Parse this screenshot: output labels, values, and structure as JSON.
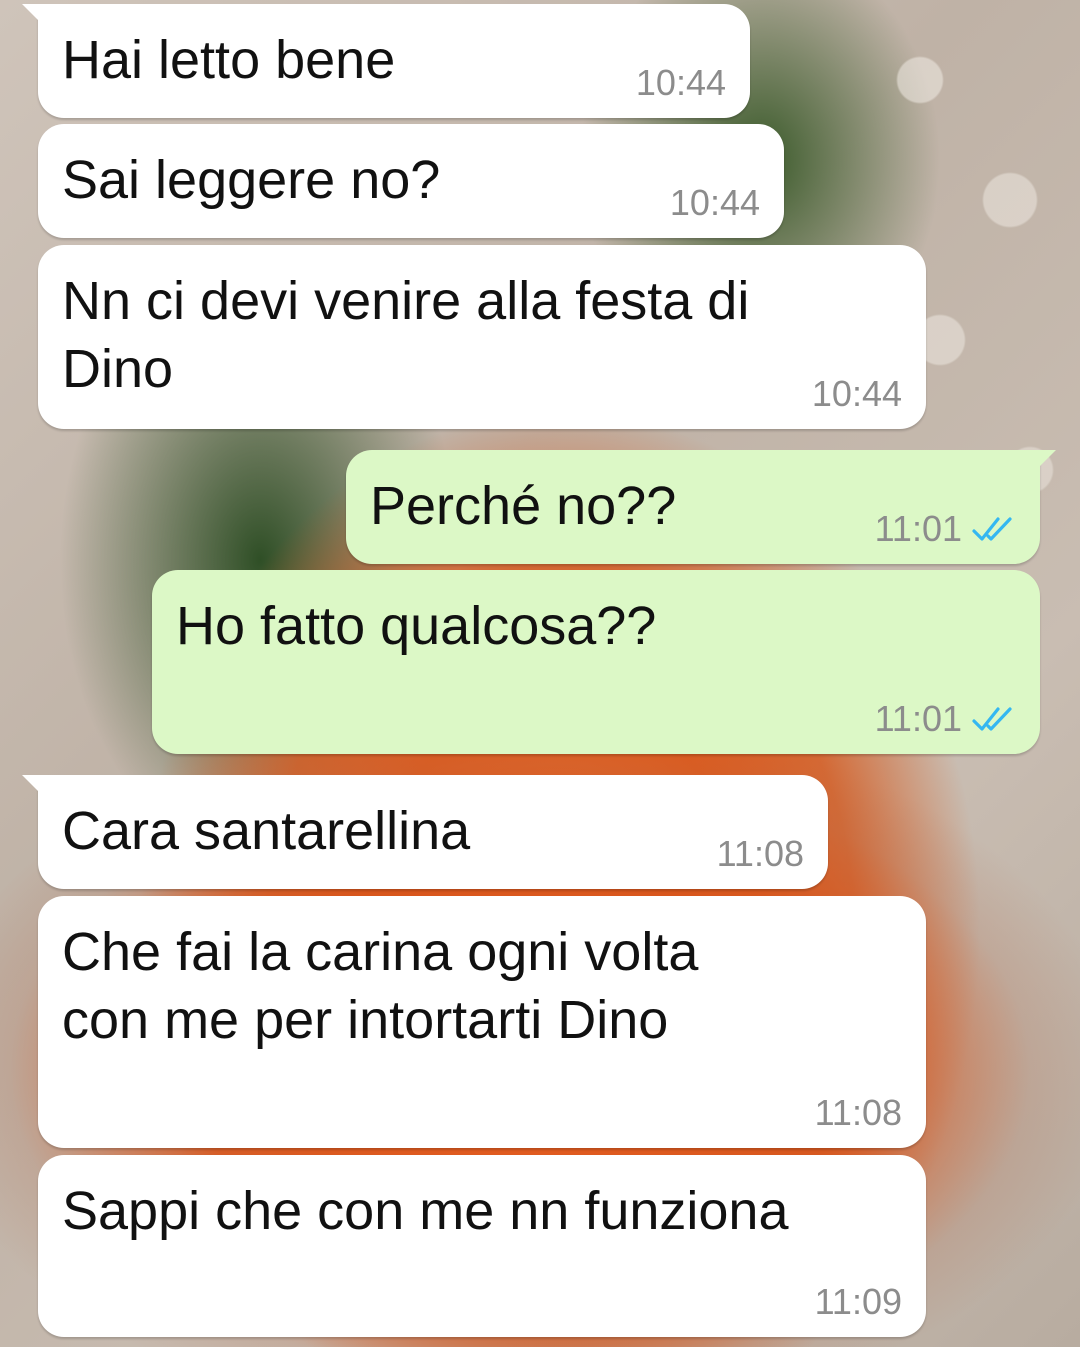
{
  "messages": [
    {
      "direction": "in",
      "text": "Hai letto bene",
      "time": "10:44"
    },
    {
      "direction": "in",
      "text": "Sai leggere no?",
      "time": "10:44"
    },
    {
      "direction": "in",
      "text": "Nn ci devi venire alla festa di\nDino",
      "time": "10:44"
    },
    {
      "direction": "out",
      "text": "Perché no??",
      "time": "11:01",
      "status": "read"
    },
    {
      "direction": "out",
      "text": "Ho fatto qualcosa??",
      "time": "11:01",
      "status": "read"
    },
    {
      "direction": "in",
      "text": "Cara santarellina",
      "time": "11:08"
    },
    {
      "direction": "in",
      "text": "Che fai la carina ogni volta\ncon me per intortarti Dino",
      "time": "11:08"
    },
    {
      "direction": "in",
      "text": "Sappi che con me nn funziona",
      "time": "11:09"
    }
  ],
  "colors": {
    "incoming_bubble": "#ffffff",
    "outgoing_bubble": "#dcf8c6",
    "read_ticks": "#34b7f1",
    "timestamp": "#8c8c8c"
  },
  "icons": {
    "read_status": "double-check-icon"
  }
}
